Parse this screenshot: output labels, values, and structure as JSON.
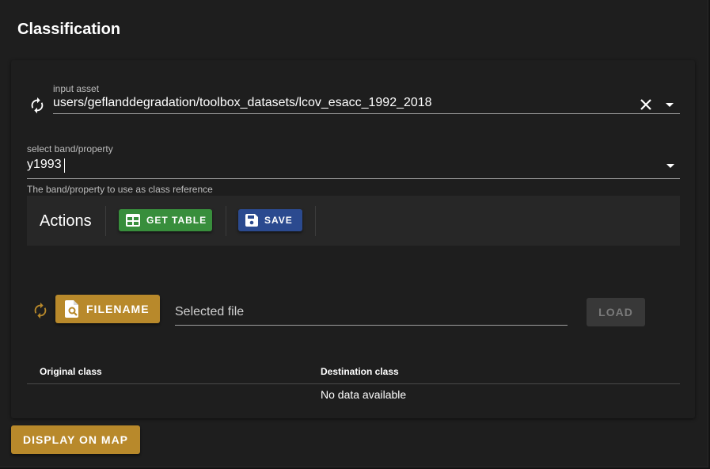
{
  "panel": {
    "title": "Classification"
  },
  "input_asset": {
    "label": "input asset",
    "value": "users/geflanddegradation/toolbox_datasets/lcov_esacc_1992_2018",
    "icons": [
      "refresh-icon",
      "close-icon",
      "caret-down-icon"
    ]
  },
  "band": {
    "label": "select band/property",
    "value": "y1993",
    "hint": "The band/property to use as class reference"
  },
  "actions": {
    "title": "Actions",
    "get_table_label": "GET TABLE",
    "save_label": "SAVE",
    "get_table_color": "#388e3c",
    "save_color": "#2b4a8f"
  },
  "file": {
    "filename_label": "FILENAME",
    "placeholder": "Selected file",
    "load_label": "LOAD",
    "accent_color": "#b8892b"
  },
  "table": {
    "columns": [
      "Original class",
      "Destination class"
    ],
    "empty_text": "No data available"
  },
  "footer": {
    "display_label": "DISPLAY ON MAP"
  }
}
